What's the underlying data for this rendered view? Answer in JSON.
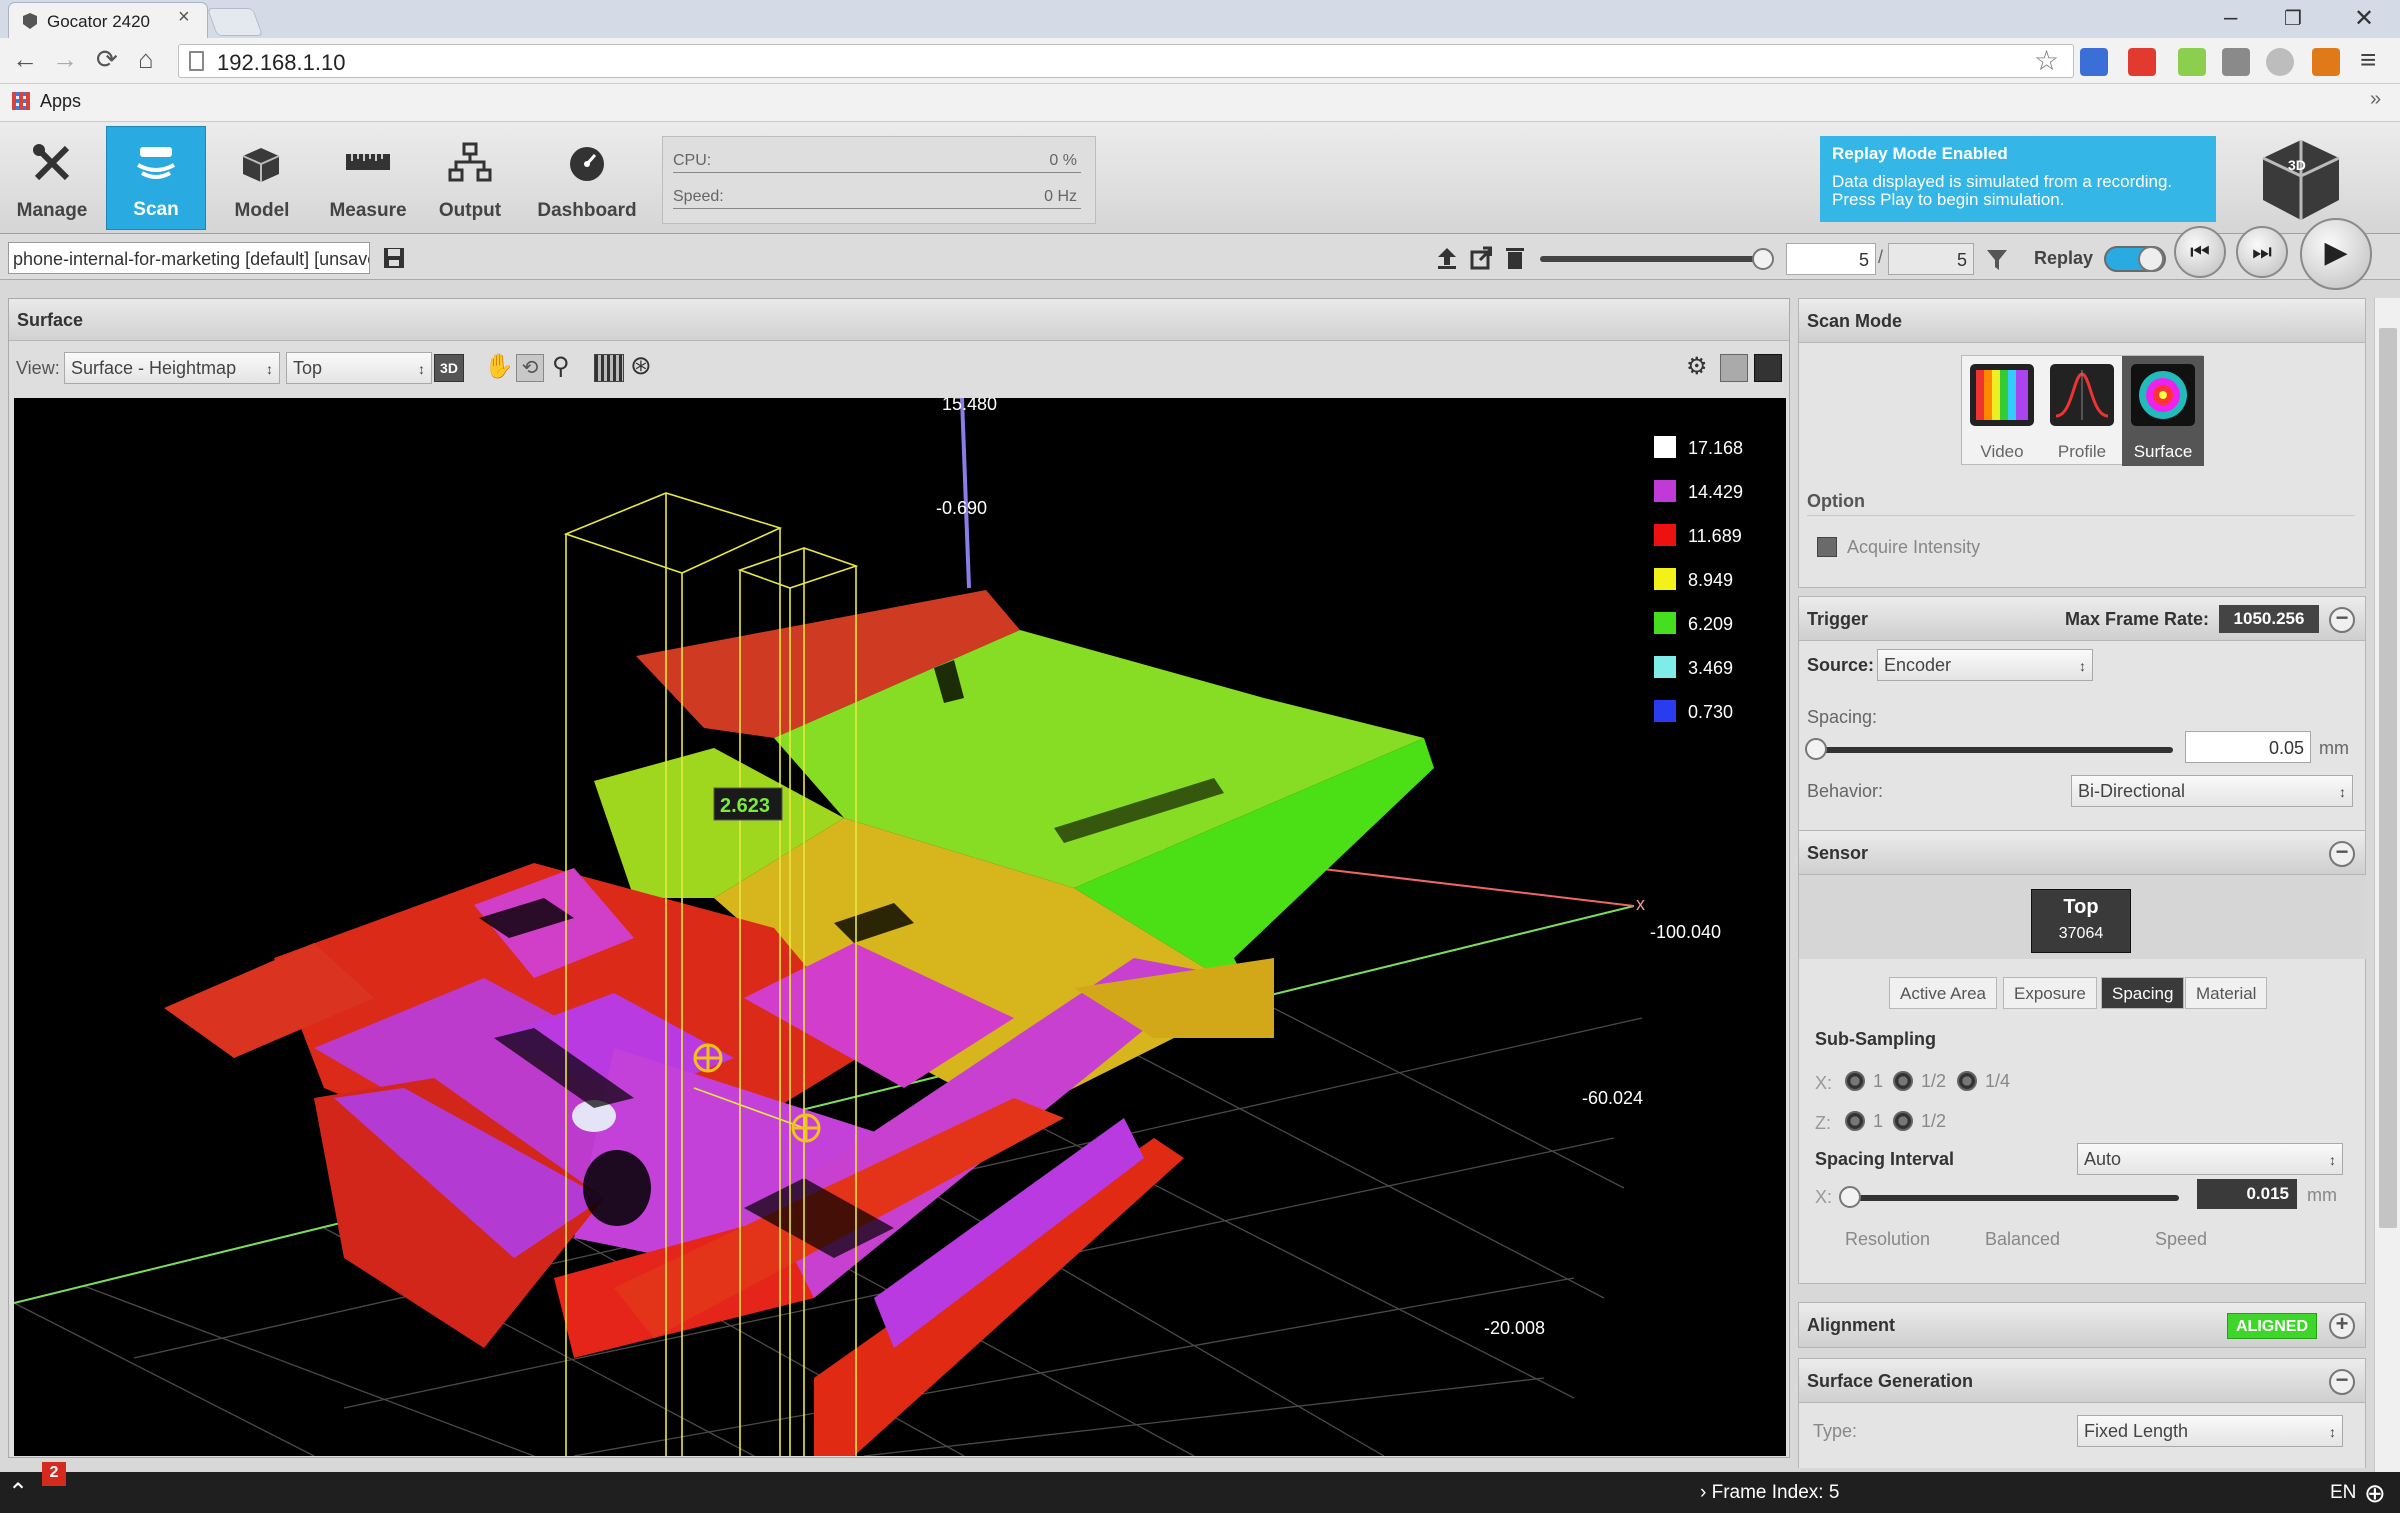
{
  "browser": {
    "tab_title": "Gocator 2420",
    "url": "192.168.1.10",
    "bookmarks_label": "Apps",
    "bookmarks_overflow": "»"
  },
  "toolbar": {
    "buttons": [
      {
        "label": "Manage",
        "icon": "wrench-screwdriver-icon"
      },
      {
        "label": "Scan",
        "icon": "scan-sensor-icon",
        "active": true
      },
      {
        "label": "Model",
        "icon": "model-blocks-icon"
      },
      {
        "label": "Measure",
        "icon": "ruler-icon"
      },
      {
        "label": "Output",
        "icon": "network-output-icon"
      },
      {
        "label": "Dashboard",
        "icon": "gauge-icon"
      }
    ],
    "cpu_label": "CPU:",
    "cpu_value": "0 %",
    "speed_label": "Speed:",
    "speed_value": "0 Hz",
    "replay_title": "Replay Mode Enabled",
    "replay_text_1": "Data displayed is simulated from a recording.",
    "replay_text_2": "Press Play to begin simulation."
  },
  "jobrow": {
    "job_name": "phone-internal-for-marketing [default] [unsaved]",
    "frame_current": "5",
    "frame_separator": "/",
    "frame_total": "5",
    "replay_label": "Replay"
  },
  "surface": {
    "title": "Surface",
    "view_label": "View:",
    "view_select": "Surface - Heightmap",
    "side_select": "Top",
    "mode_3d": "3D",
    "measure_value": "2.623",
    "axis_labels": {
      "z_top": "15.480",
      "z": "-0.690",
      "x": "x",
      "y1": "-100.040",
      "y2": "-60.024",
      "y3": "-20.008"
    },
    "legend": [
      {
        "value": "17.168",
        "color": "#ffffff"
      },
      {
        "value": "14.429",
        "color": "#c03ad8"
      },
      {
        "value": "11.689",
        "color": "#ee1111"
      },
      {
        "value": "8.949",
        "color": "#f2f21a"
      },
      {
        "value": "6.209",
        "color": "#44e020"
      },
      {
        "value": "3.469",
        "color": "#80ecea"
      },
      {
        "value": "0.730",
        "color": "#2a3cf0"
      }
    ]
  },
  "scan_mode": {
    "title": "Scan Mode",
    "modes": [
      "Video",
      "Profile",
      "Surface"
    ],
    "selected": "Surface",
    "option_label": "Option",
    "acquire_intensity": "Acquire Intensity"
  },
  "trigger": {
    "title": "Trigger",
    "max_frame_rate_label": "Max Frame Rate:",
    "max_frame_rate": "1050.256",
    "source_label": "Source:",
    "source_value": "Encoder",
    "spacing_label": "Spacing:",
    "spacing_value": "0.05",
    "spacing_unit": "mm",
    "behavior_label": "Behavior:",
    "behavior_value": "Bi-Directional"
  },
  "sensor": {
    "title": "Sensor",
    "name": "Top",
    "serial": "37064",
    "tabs": [
      "Active Area",
      "Exposure",
      "Spacing",
      "Material"
    ],
    "active_tab": "Spacing",
    "subsampling_label": "Sub-Sampling",
    "x_label": "X:",
    "z_label": "Z:",
    "x_options": [
      "1",
      "1/2",
      "1/4"
    ],
    "z_options": [
      "1",
      "1/2"
    ],
    "spacing_interval_label": "Spacing Interval",
    "spacing_interval_value": "Auto",
    "interval_value": "0.015",
    "interval_unit": "mm",
    "scale_labels": [
      "Resolution",
      "Balanced",
      "Speed"
    ]
  },
  "alignment": {
    "title": "Alignment",
    "status": "ALIGNED",
    "status_color": "#3fd62a"
  },
  "surface_generation": {
    "title": "Surface Generation",
    "type_label": "Type:",
    "type_value": "Fixed Length"
  },
  "statusbar": {
    "badge": "2",
    "frame_index": "Frame Index: 5",
    "language": "EN"
  }
}
